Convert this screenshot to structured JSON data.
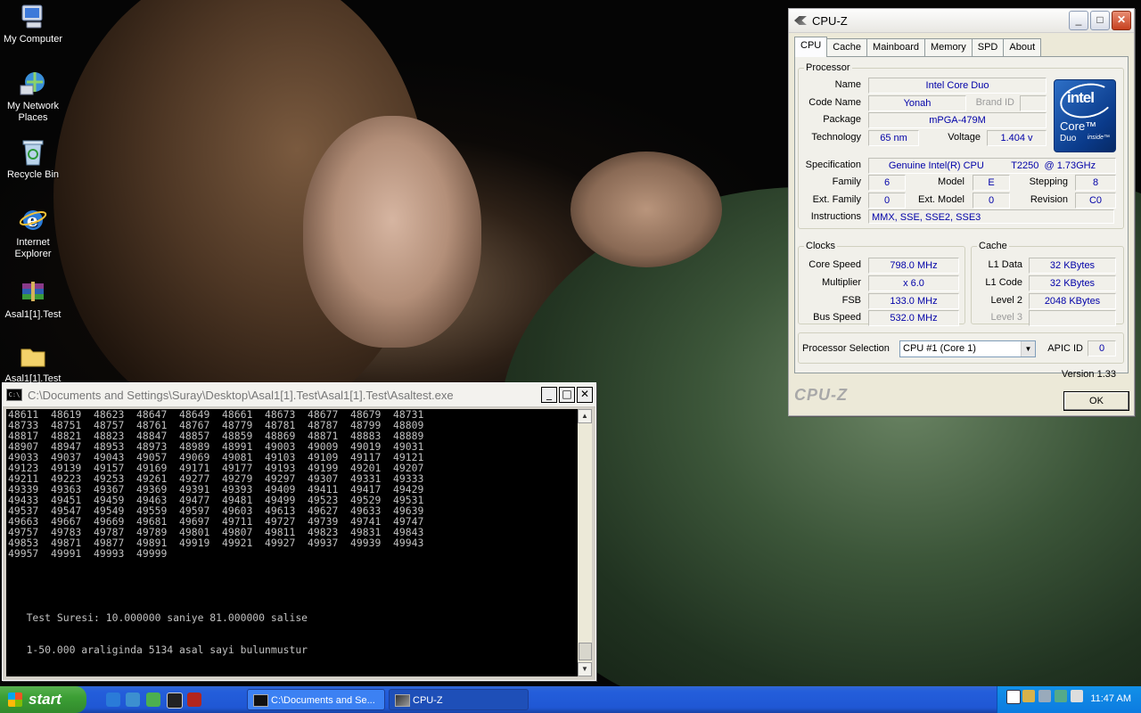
{
  "desktop": {
    "icons": [
      {
        "label": "My Computer",
        "icon": "my-computer-icon"
      },
      {
        "label": "My Network Places",
        "icon": "network-places-icon"
      },
      {
        "label": "Recycle Bin",
        "icon": "recycle-bin-icon"
      },
      {
        "label": "Internet Explorer",
        "icon": "internet-explorer-icon"
      },
      {
        "label": "Asal1[1].Test",
        "icon": "winrar-archive-icon"
      },
      {
        "label": "Asal1[1].Test",
        "icon": "folder-icon"
      }
    ]
  },
  "console": {
    "title": "C:\\Documents and Settings\\Suray\\Desktop\\Asal1[1].Test\\Asal1[1].Test\\Asaltest.exe",
    "app_icon": "C:\\",
    "minimize": "_",
    "maximize": "□",
    "close": "✕",
    "scroll_up": "▲",
    "scroll_down": "▼",
    "lines": [
      "48611  48619  48623  48647  48649  48661  48673  48677  48679  48731",
      "48733  48751  48757  48761  48767  48779  48781  48787  48799  48809",
      "48817  48821  48823  48847  48857  48859  48869  48871  48883  48889",
      "48907  48947  48953  48973  48989  48991  49003  49009  49019  49031",
      "49033  49037  49043  49057  49069  49081  49103  49109  49117  49121",
      "49123  49139  49157  49169  49171  49177  49193  49199  49201  49207",
      "49211  49223  49253  49261  49277  49279  49297  49307  49331  49333",
      "49339  49363  49367  49369  49391  49393  49409  49411  49417  49429",
      "49433  49451  49459  49463  49477  49481  49499  49523  49529  49531",
      "49537  49547  49549  49559  49597  49603  49613  49627  49633  49639",
      "49663  49667  49669  49681  49697  49711  49727  49739  49741  49747",
      "49757  49783  49787  49789  49801  49807  49811  49823  49831  49843",
      "49853  49871  49877  49891  49919  49921  49927  49937  49939  49943",
      "49957  49991  49993  49999",
      "",
      "",
      "",
      "",
      "",
      "   Test Suresi: 10.000000 saniye 81.000000 salise",
      "",
      "",
      "   1-50.000 araliginda 5134 asal sayi bulunmustur"
    ]
  },
  "cpuz": {
    "title": "CPU-Z",
    "minimize": "_",
    "maximize": "□",
    "close": "✕",
    "tabs": [
      "CPU",
      "Cache",
      "Mainboard",
      "Memory",
      "SPD",
      "About"
    ],
    "processor": {
      "legend": "Processor",
      "name_label": "Name",
      "name": "Intel Core Duo",
      "codename_label": "Code Name",
      "codename": "Yonah",
      "brandid_label": "Brand ID",
      "brandid": "",
      "package_label": "Package",
      "package": "mPGA-479M",
      "technology_label": "Technology",
      "technology": "65 nm",
      "voltage_label": "Voltage",
      "voltage": "1.404 v",
      "spec_label": "Specification",
      "spec": "Genuine Intel(R) CPU          T2250  @ 1.73GHz",
      "family_label": "Family",
      "family": "6",
      "model_label": "Model",
      "model": "E",
      "stepping_label": "Stepping",
      "stepping": "8",
      "extfamily_label": "Ext. Family",
      "extfamily": "0",
      "extmodel_label": "Ext. Model",
      "extmodel": "0",
      "revision_label": "Revision",
      "revision": "C0",
      "instructions_label": "Instructions",
      "instructions": "MMX, SSE, SSE2, SSE3"
    },
    "logo": {
      "brand": "intel",
      "line1": "Core™",
      "line2": "Duo",
      "inside": "inside™"
    },
    "clocks": {
      "legend": "Clocks",
      "core_label": "Core Speed",
      "core": "798.0 MHz",
      "mult_label": "Multiplier",
      "mult": "x 6.0",
      "fsb_label": "FSB",
      "fsb": "133.0 MHz",
      "bus_label": "Bus Speed",
      "bus": "532.0 MHz"
    },
    "cache": {
      "legend": "Cache",
      "l1d_label": "L1 Data",
      "l1d": "32 KBytes",
      "l1c_label": "L1 Code",
      "l1c": "32 KBytes",
      "l2_label": "Level 2",
      "l2": "2048 KBytes",
      "l3_label": "Level 3",
      "l3": ""
    },
    "selection_label": "Processor Selection",
    "selection": "CPU #1 (Core 1)",
    "apic_label": "APIC ID",
    "apic": "0",
    "version": "Version 1.33",
    "footer_brand": "CPU-Z",
    "ok": "OK"
  },
  "taskbar": {
    "start": "start",
    "quicklaunch": [
      "internet-explorer-icon",
      "outlook-icon",
      "msn-icon",
      "media-icon",
      "winrar-icon"
    ],
    "buttons": [
      {
        "label": "C:\\Documents and Se...",
        "icon": "console-icon"
      },
      {
        "label": "CPU-Z",
        "icon": "cpuz-icon"
      }
    ],
    "tray_icons": [
      "language-icon",
      "network-icon",
      "volume-icon",
      "tray-app-icon",
      "tray-app-icon-2"
    ],
    "clock": "11:47 AM"
  }
}
